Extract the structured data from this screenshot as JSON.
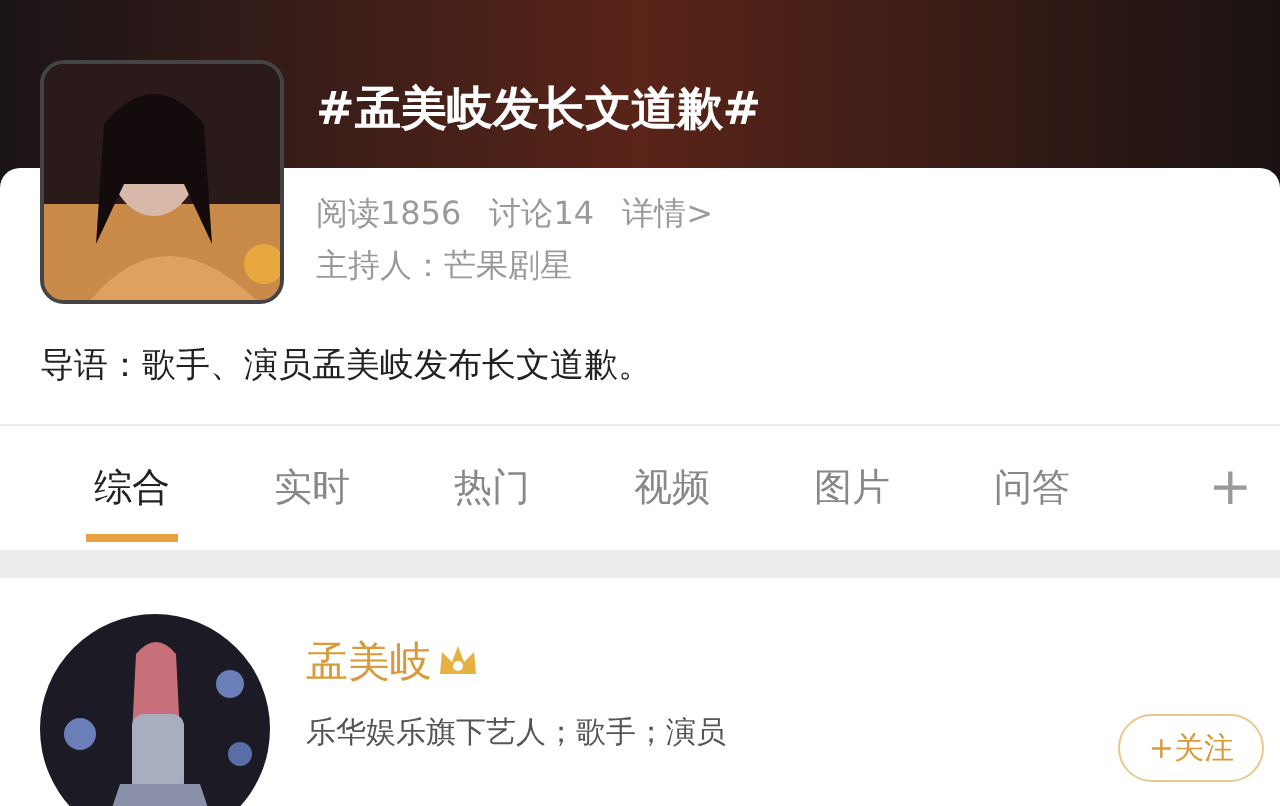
{
  "topic": {
    "title": "#孟美岐发长文道歉#",
    "stats": [
      "阅读1856",
      "讨论14",
      "详情>"
    ],
    "host": "主持人：芒果剧星",
    "intro": "导语：歌手、演员孟美岐发布长文道歉。"
  },
  "tabs": [
    {
      "label": "综合",
      "selected": true
    },
    {
      "label": "实时",
      "selected": false
    },
    {
      "label": "热门",
      "selected": false
    },
    {
      "label": "视频",
      "selected": false
    },
    {
      "label": "图片",
      "selected": false
    },
    {
      "label": "问答",
      "selected": false
    }
  ],
  "add_tab": "+",
  "user": {
    "name": "孟美岐",
    "verified": true,
    "description": "乐华娱乐旗下艺人；歌手；演员",
    "follow": "+关注"
  }
}
